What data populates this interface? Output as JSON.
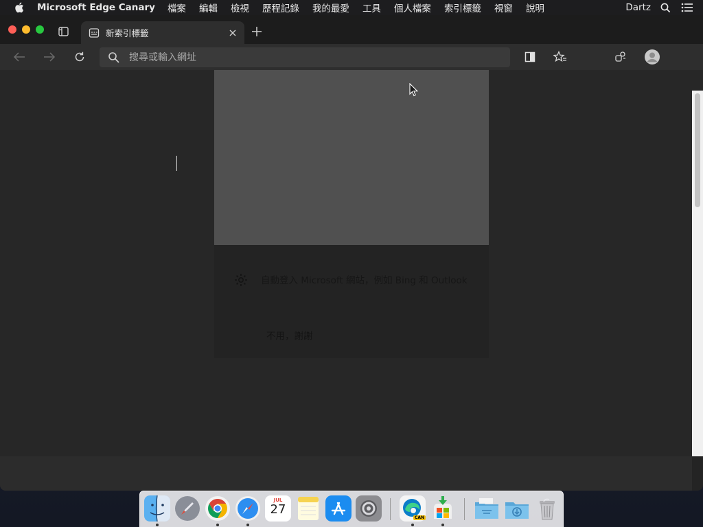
{
  "menubar": {
    "app_name": "Microsoft Edge Canary",
    "items": [
      "檔案",
      "編輯",
      "檢視",
      "歷程記錄",
      "我的最愛",
      "工具",
      "個人檔案",
      "索引標籤",
      "視窗",
      "說明"
    ],
    "user": "Dartz"
  },
  "tab": {
    "title": "新索引標籤"
  },
  "address_bar": {
    "placeholder": "搜尋或輸入網址",
    "value": ""
  },
  "signin_card": {
    "message": "自動登入 Microsoft 網站，例如 Bing 和 Outlook",
    "decline_label": "不用，謝謝"
  },
  "dock": {
    "apps": [
      {
        "name": "Finder",
        "running": true
      },
      {
        "name": "Launchpad",
        "running": false
      },
      {
        "name": "Google Chrome",
        "running": true
      },
      {
        "name": "Safari",
        "running": true
      },
      {
        "name": "Calendar",
        "running": false,
        "month": "JUL",
        "day": "27"
      },
      {
        "name": "Notes",
        "running": false
      },
      {
        "name": "App Store",
        "running": false
      },
      {
        "name": "System Preferences",
        "running": false
      },
      {
        "name": "Microsoft Edge Canary",
        "running": true,
        "badge": "CAN"
      },
      {
        "name": "Microsoft Installer",
        "running": true
      },
      {
        "name": "Applications Folder",
        "running": false
      },
      {
        "name": "Downloads Folder",
        "running": false
      },
      {
        "name": "Trash",
        "running": false
      }
    ]
  },
  "colors": {
    "menubar_bg": "#1d1d1f",
    "tab_active_bg": "#2e2e2e",
    "content_bg": "#272727",
    "card_hero_bg": "#505050"
  }
}
